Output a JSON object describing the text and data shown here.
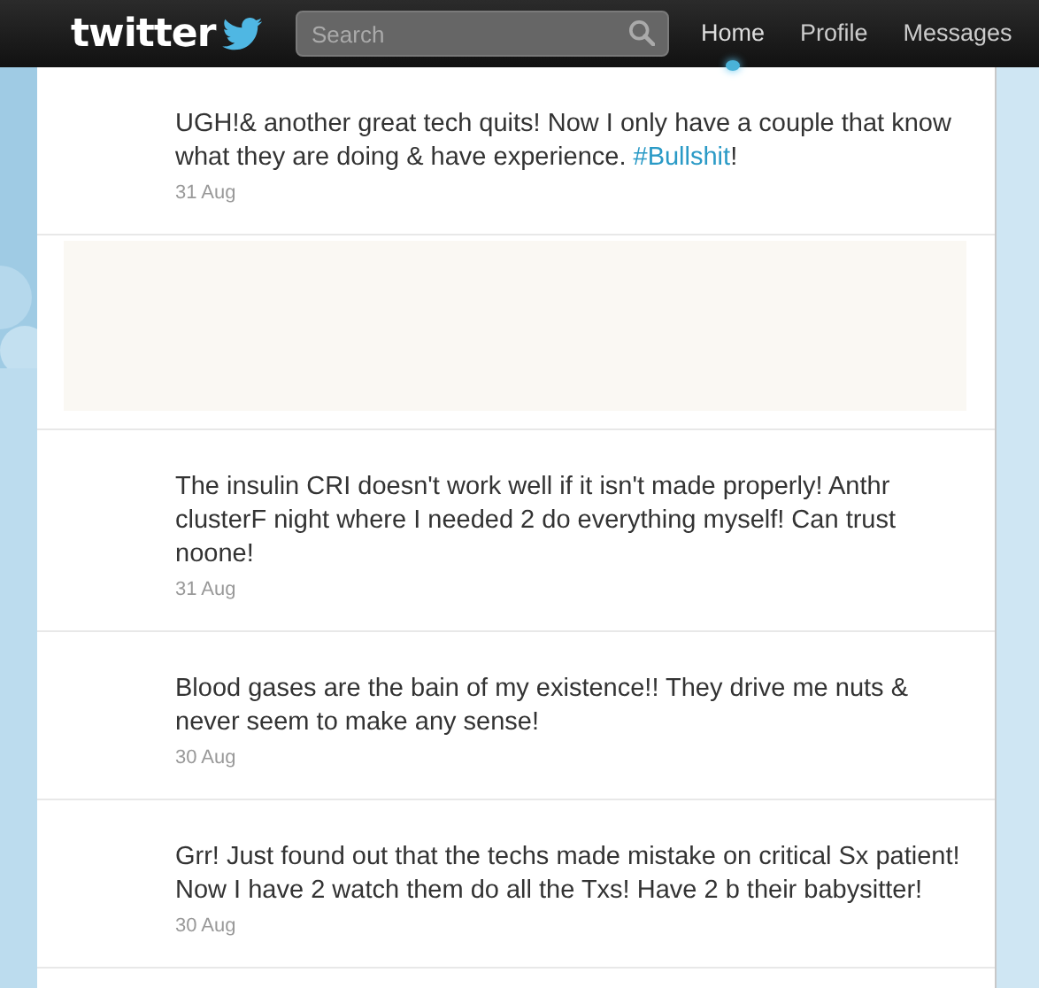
{
  "topbar": {
    "logo": "twitter",
    "search": {
      "placeholder": "Search"
    },
    "nav": [
      {
        "label": "Home",
        "selected": true
      },
      {
        "label": "Profile",
        "selected": false
      },
      {
        "label": "Messages",
        "selected": false
      }
    ]
  },
  "timeline": [
    {
      "kind": "tweet",
      "parts": [
        {
          "kind": "plain",
          "text": "UGH!& another great tech quits! Now I only have a couple that know what they are doing & have experience. "
        },
        {
          "kind": "hashtag",
          "text": "#Bullshit"
        },
        {
          "kind": "plain",
          "text": "!"
        }
      ],
      "date": "31 Aug"
    },
    {
      "kind": "blank"
    },
    {
      "kind": "tweet",
      "parts": [
        {
          "kind": "plain",
          "text": "The insulin CRI doesn't work well if it isn't made properly! Anthr clusterF night where I needed 2 do everything myself! Can trust noone!"
        }
      ],
      "date": "31 Aug"
    },
    {
      "kind": "tweet",
      "parts": [
        {
          "kind": "plain",
          "text": "Blood gases are the bain of my existence!! They drive me nuts & never seem to make any sense!"
        }
      ],
      "date": "30 Aug"
    },
    {
      "kind": "tweet",
      "parts": [
        {
          "kind": "plain",
          "text": "Grr! Just found out that the techs made mistake on critical Sx patient! Now I have 2 watch them do all the Txs! Have 2 b their babysitter!"
        }
      ],
      "date": "30 Aug"
    }
  ]
}
